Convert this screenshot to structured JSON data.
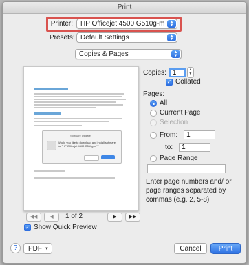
{
  "window": {
    "title": "Print"
  },
  "printer": {
    "label": "Printer:",
    "value": "HP Officejet 4500 G510g-m"
  },
  "presets": {
    "label": "Presets:",
    "value": "Default Settings"
  },
  "section": {
    "value": "Copies & Pages"
  },
  "preview": {
    "dialog_title": "Software Update",
    "dialog_message": "Would you like to download and install software for \"HP Officejet 4500 G510g-m\"?"
  },
  "pagination": {
    "text": "1 of 2",
    "first": "◀◀",
    "prev": "◀",
    "next": "▶",
    "last": "▶▶"
  },
  "quick_preview": {
    "label": "Show Quick Preview",
    "checked": true
  },
  "copies": {
    "label": "Copies:",
    "value": "1"
  },
  "collated": {
    "label": "Collated",
    "checked": true
  },
  "pages": {
    "label": "Pages:",
    "all": "All",
    "current": "Current Page",
    "selection": "Selection",
    "from_label": "From:",
    "from_value": "1",
    "to_label": "to:",
    "to_value": "1",
    "range_label": "Page Range",
    "range_value": "",
    "hint": "Enter page numbers and/ or page ranges separated by commas (e.g. 2, 5-8)"
  },
  "footer": {
    "help": "?",
    "pdf": "PDF",
    "cancel": "Cancel",
    "print": "Print"
  },
  "colors": {
    "accent": "#2e6fe0",
    "highlight_border": "#d9534f"
  },
  "icons": {
    "help": "help-icon",
    "popup": "updown-arrows-icon",
    "check": "checkmark-icon"
  }
}
